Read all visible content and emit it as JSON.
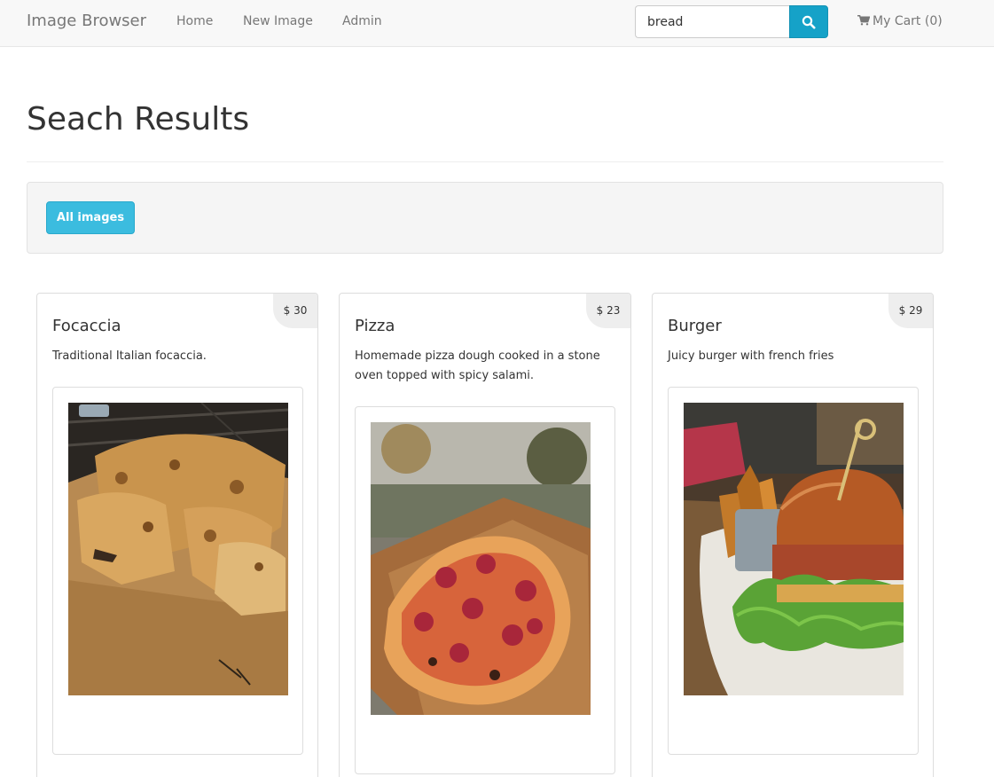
{
  "navbar": {
    "brand": "Image Browser",
    "links": [
      "Home",
      "New Image",
      "Admin"
    ],
    "search": {
      "value": "bread"
    },
    "cart_label": "My Cart (0)"
  },
  "page": {
    "title": "Seach Results",
    "filter_button": "All images"
  },
  "products": [
    {
      "name": "Focaccia",
      "price": "$ 30",
      "description": "Traditional Italian focaccia."
    },
    {
      "name": "Pizza",
      "price": "$ 23",
      "description": "Homemade pizza dough cooked in a stone oven topped with spicy salami."
    },
    {
      "name": "Burger",
      "price": "$ 29",
      "description": "Juicy burger with french fries"
    }
  ],
  "colors": {
    "navbar_bg": "#f8f8f8",
    "search_button": "#15a2c8",
    "filter_button": "#3bbcdf",
    "well_bg": "#f5f5f5",
    "price_badge_bg": "#eeeeee"
  },
  "icons": {
    "search": "search-icon",
    "cart": "shopping-cart-icon"
  }
}
